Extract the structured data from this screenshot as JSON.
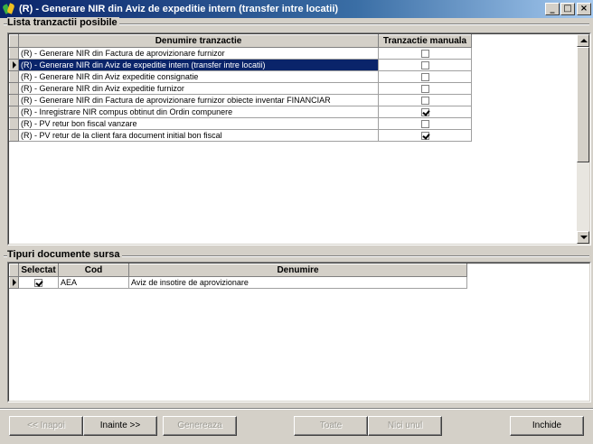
{
  "window": {
    "title": "(R) - Generare NIR din Aviz de expeditie intern (transfer intre locatii)",
    "controls": {
      "minimize": "_",
      "maximize": "□",
      "close": "×"
    }
  },
  "transactions": {
    "group_label": "Lista tranzactii posibile",
    "columns": [
      "Denumire tranzactie",
      "Tranzactie manuala"
    ],
    "rows": [
      {
        "name": "(R) - Generare NIR din Factura de aprovizionare furnizor",
        "manual": false,
        "selected": false
      },
      {
        "name": "(R) - Generare NIR din Aviz de expeditie intern (transfer intre locatii)",
        "manual": false,
        "selected": true
      },
      {
        "name": "(R) - Generare NIR din Aviz expeditie consignatie",
        "manual": false,
        "selected": false
      },
      {
        "name": "(R) - Generare NIR din Aviz expeditie furnizor",
        "manual": false,
        "selected": false
      },
      {
        "name": "(R) - Generare NIR din Factura de aprovizionare furnizor obiecte inventar FINANCIAR",
        "manual": false,
        "selected": false
      },
      {
        "name": "(R) - Inregistrare NIR compus obtinut din Ordin compunere",
        "manual": true,
        "selected": false
      },
      {
        "name": "(R) - PV retur bon fiscal vanzare",
        "manual": false,
        "selected": false
      },
      {
        "name": "(R) - PV retur de la client fara document initial bon fiscal",
        "manual": true,
        "selected": false
      }
    ]
  },
  "source_docs": {
    "group_label": "Tipuri documente sursa",
    "columns": [
      "Selectat",
      "Cod",
      "Denumire"
    ],
    "rows": [
      {
        "selected": true,
        "code": "AEA",
        "name": "Aviz de insotire de aprovizionare"
      }
    ]
  },
  "buttons": {
    "back": "<< Inapoi",
    "next": "Inainte >>",
    "generate": "Genereaza",
    "all": "Toate",
    "none": "Nici unul",
    "close": "Inchide"
  },
  "colors": {
    "selection": "#0a246a",
    "titlebar": "#0a246a",
    "face": "#d4d0c8"
  }
}
